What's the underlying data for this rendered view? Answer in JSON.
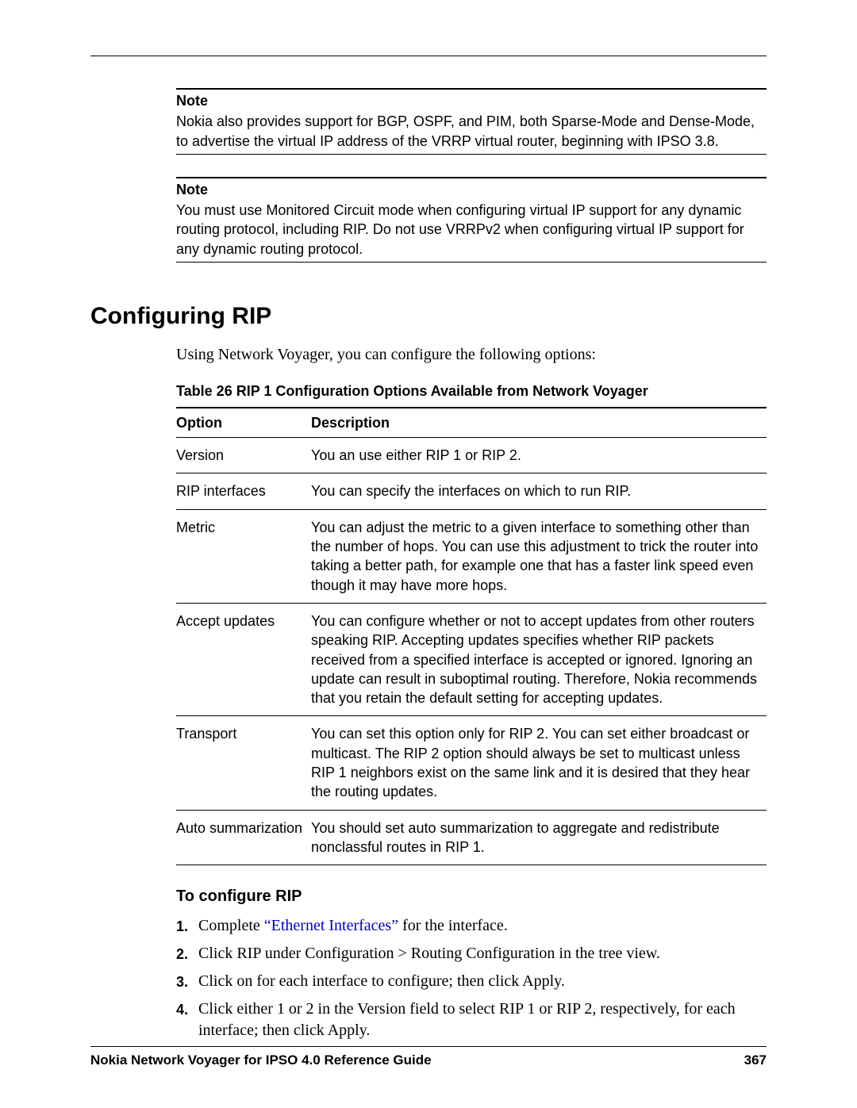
{
  "notes": {
    "label": "Note",
    "first": "Nokia also provides support for BGP, OSPF, and PIM, both Sparse-Mode and Dense-Mode, to advertise the virtual IP address of the VRRP virtual router, beginning with IPSO 3.8.",
    "second": "You must use Monitored Circuit mode when configuring virtual IP support for any dynamic routing protocol, including RIP. Do not use VRRPv2 when configuring virtual IP support for any dynamic routing protocol."
  },
  "heading": "Configuring RIP",
  "intro": "Using Network Voyager, you can configure the following options:",
  "table": {
    "caption": "Table 26  RIP 1 Configuration Options Available from Network Voyager",
    "head_option": "Option",
    "head_desc": "Description",
    "rows": [
      {
        "opt": "Version",
        "desc": "You an use either RIP 1 or RIP 2."
      },
      {
        "opt": "RIP interfaces",
        "desc": "You can specify the interfaces on which to run RIP."
      },
      {
        "opt": "Metric",
        "desc": "You can adjust the metric to a given interface to something other than the number of hops. You can use this adjustment to trick the router into taking a better path, for example one that has a faster link speed even though it may have more hops."
      },
      {
        "opt": "Accept updates",
        "desc": "You can configure whether or not to accept updates from other routers speaking RIP. Accepting updates specifies whether RIP packets received from a specified interface is accepted or ignored. Ignoring an update can result in suboptimal routing. Therefore, Nokia recommends that you retain the default setting for accepting updates."
      },
      {
        "opt": "Transport",
        "desc": "You can set this option only for RIP 2. You can set either broadcast or multicast. The RIP 2 option should always be set to multicast unless RIP 1 neighbors exist on the same link and it is desired that they hear the routing updates."
      },
      {
        "opt": "Auto summarization",
        "desc": "You should set auto summarization to aggregate and redistribute nonclassful routes in RIP 1."
      }
    ]
  },
  "proc_heading": "To configure RIP",
  "steps": {
    "s1_pre": "Complete ",
    "s1_link": "“Ethernet Interfaces”",
    "s1_post": " for the interface.",
    "s2": "Click RIP under Configuration > Routing Configuration in the tree view.",
    "s3": "Click on for each interface to configure; then click Apply.",
    "s4": "Click either 1 or 2 in the Version field to select RIP 1 or RIP 2, respectively, for each interface; then click Apply."
  },
  "step_nums": {
    "n1": "1.",
    "n2": "2.",
    "n3": "3.",
    "n4": "4."
  },
  "footer": {
    "title": "Nokia Network Voyager for IPSO 4.0 Reference Guide",
    "page": "367"
  }
}
